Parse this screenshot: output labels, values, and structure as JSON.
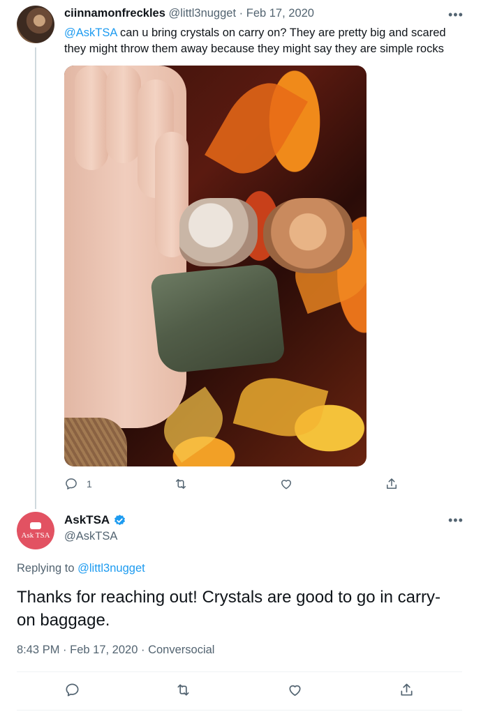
{
  "parent_tweet": {
    "display_name": "ciinnamonfreckles",
    "handle": "@littl3nugget",
    "separator": "·",
    "date": "Feb 17, 2020",
    "more_label": "•••",
    "mention": "@AskTSA",
    "text": " can u bring crystals on carry on? They are pretty big and scared they might throw them away because they might say they are simple rocks",
    "reply_count": "1",
    "icons": [
      "reply-icon",
      "retweet-icon",
      "like-icon",
      "share-icon"
    ]
  },
  "reply_tweet": {
    "avatar_text": "Ask TSA",
    "display_name": "AskTSA",
    "verified": true,
    "handle": "@AskTSA",
    "more_label": "•••",
    "replying_prefix": "Replying to ",
    "replying_to": "@littl3nugget",
    "text": "Thanks for reaching out! Crystals are good to go in carry-on baggage.",
    "time": "8:43 PM",
    "date": "Feb 17, 2020",
    "source": "Conversocial",
    "separator": "·",
    "icons": [
      "reply-icon",
      "retweet-icon",
      "like-icon",
      "share-icon"
    ]
  },
  "colors": {
    "link": "#1d9bf0",
    "muted": "#536471",
    "avatar_brand": "#e25262"
  }
}
